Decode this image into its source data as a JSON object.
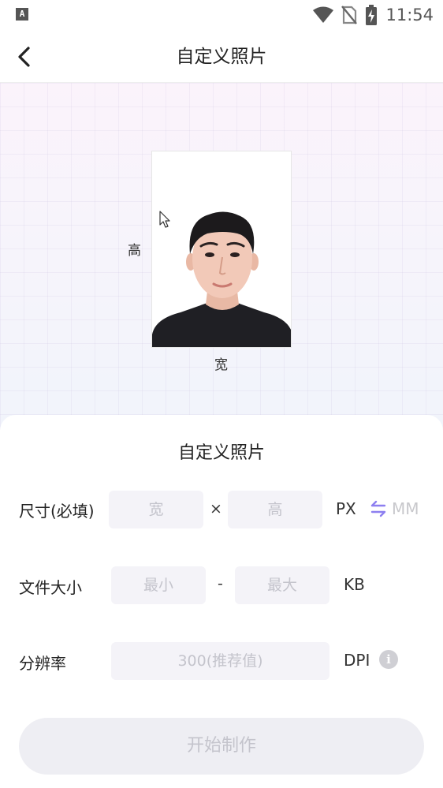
{
  "status_bar": {
    "app_badge": "A",
    "time": "11:54"
  },
  "nav": {
    "title": "自定义照片"
  },
  "preview": {
    "height_label": "高",
    "width_label": "宽"
  },
  "sheet": {
    "title": "自定义照片",
    "size_row": {
      "label": "尺寸(必填)",
      "width_placeholder": "宽",
      "separator": "×",
      "height_placeholder": "高",
      "unit_active": "PX",
      "unit_inactive": "MM"
    },
    "filesize_row": {
      "label": "文件大小",
      "min_placeholder": "最小",
      "separator": "-",
      "max_placeholder": "最大",
      "unit": "KB"
    },
    "resolution_row": {
      "label": "分辨率",
      "placeholder": "300(推荐值)",
      "unit": "DPI",
      "info_glyph": "i"
    },
    "start_button": "开始制作"
  }
}
